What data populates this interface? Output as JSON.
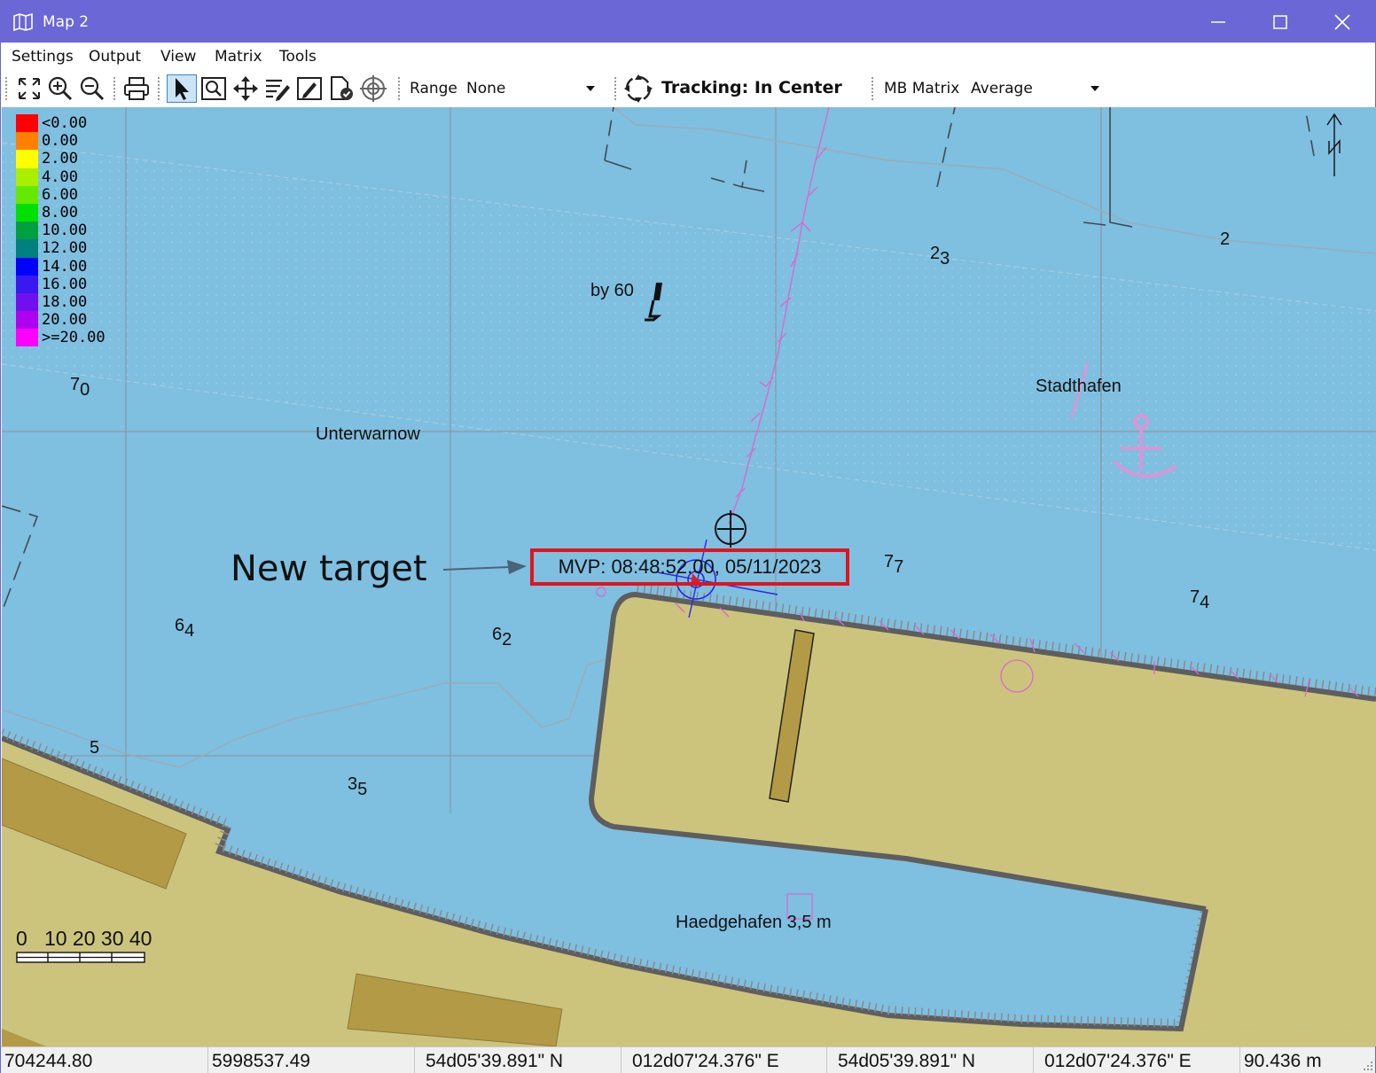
{
  "window": {
    "title": "Map 2"
  },
  "menu": [
    "Settings",
    "Output",
    "View",
    "Matrix",
    "Tools"
  ],
  "toolbar": {
    "range_label": "Range",
    "range_value": "None",
    "tracking_label": "Tracking: In Center",
    "mb_matrix_label": "MB Matrix",
    "mb_matrix_value": "Average"
  },
  "legend": [
    {
      "color": "#ff0000",
      "label": "<0.00"
    },
    {
      "color": "#ff7f00",
      "label": "0.00"
    },
    {
      "color": "#ffff00",
      "label": "2.00"
    },
    {
      "color": "#a8f000",
      "label": "4.00"
    },
    {
      "color": "#66e800",
      "label": "6.00"
    },
    {
      "color": "#00e000",
      "label": "8.00"
    },
    {
      "color": "#00a040",
      "label": "10.00"
    },
    {
      "color": "#008080",
      "label": "12.00"
    },
    {
      "color": "#0000ff",
      "label": "14.00"
    },
    {
      "color": "#3a18f0",
      "label": "16.00"
    },
    {
      "color": "#7010f0",
      "label": "18.00"
    },
    {
      "color": "#b000f0",
      "label": "20.00"
    },
    {
      "color": "#ff00ff",
      "label": ">=20.00"
    }
  ],
  "map_labels": {
    "by60": "by 60",
    "unterwarnow": "Unterwarnow",
    "stadthafen": "Stadthafen",
    "haedgehafen": "Haedgehafen 3,5 m",
    "depth_2": "2",
    "depth_5": "5"
  },
  "depths": [
    {
      "main": "7",
      "sub": "0"
    },
    {
      "main": "2",
      "sub": "3"
    },
    {
      "main": "7",
      "sub": "7"
    },
    {
      "main": "7",
      "sub": "4"
    },
    {
      "main": "6",
      "sub": "4"
    },
    {
      "main": "6",
      "sub": "2"
    },
    {
      "main": "3",
      "sub": "5"
    }
  ],
  "mvp_label": "MVP: 08:48:52.00, 05/11/2023",
  "annotation": "New target",
  "scale": {
    "labels": "0   10 20 30 40"
  },
  "status": {
    "easting": "704244.80",
    "northing": "5998537.49",
    "lat1": "54d05'39.891\" N",
    "lon1": "012d07'24.376\" E",
    "lat2": "54d05'39.891\" N",
    "lon2": "012d07'24.376\" E",
    "distance": "90.436 m"
  },
  "colors": {
    "titlebar": "#6b67d6",
    "water": "#7fbfe0",
    "land": "#ccc47c",
    "building": "#b39a46",
    "highlight": "#e0141e"
  }
}
